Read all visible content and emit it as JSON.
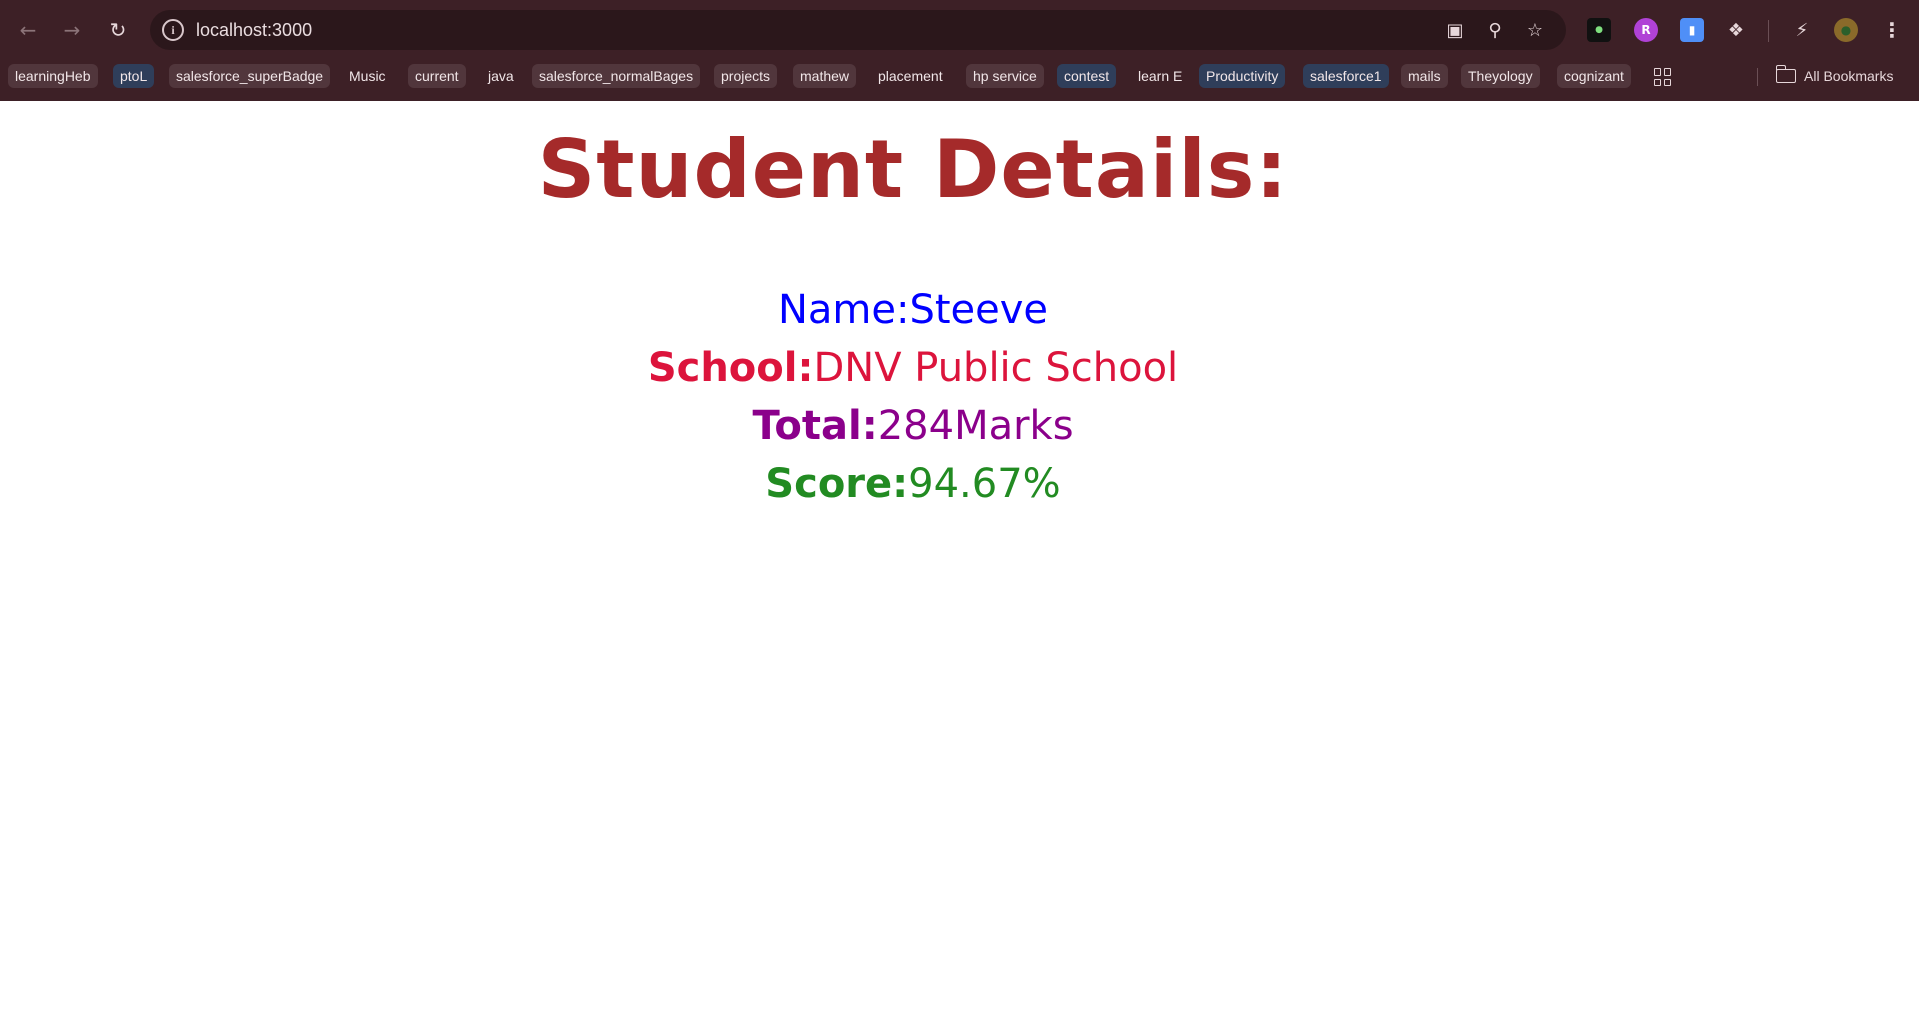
{
  "browser": {
    "url": "localhost:3000",
    "bookmarks": [
      {
        "label": "learningHeb",
        "style": "chip"
      },
      {
        "label": "ptoL",
        "style": "blue"
      },
      {
        "label": "salesforce_superBadge",
        "style": "chip"
      },
      {
        "label": "Music",
        "style": "plain"
      },
      {
        "label": "current",
        "style": "chip"
      },
      {
        "label": "java",
        "style": "plain"
      },
      {
        "label": "salesforce_normalBages",
        "style": "chip"
      },
      {
        "label": "projects",
        "style": "chip"
      },
      {
        "label": "mathew",
        "style": "chip"
      },
      {
        "label": "placement",
        "style": "plain"
      },
      {
        "label": "hp service",
        "style": "chip"
      },
      {
        "label": "contest",
        "style": "blue"
      },
      {
        "label": "learn E",
        "style": "plain"
      },
      {
        "label": "Productivity",
        "style": "blue"
      },
      {
        "label": "salesforce1",
        "style": "blue"
      },
      {
        "label": "mails",
        "style": "chip"
      },
      {
        "label": "Theyology",
        "style": "chip"
      },
      {
        "label": "cognizant",
        "style": "chip"
      }
    ],
    "all_bookmarks_label": "All Bookmarks",
    "icons": {
      "back": "arrow-left-icon",
      "forward": "arrow-right-icon",
      "reload": "reload-icon",
      "site_info": "info-icon",
      "install": "install-app-icon",
      "zoom": "zoom-icon",
      "bookmark": "star-icon",
      "extensions": "puzzle-icon",
      "menu": "kebab-menu-icon"
    }
  },
  "page": {
    "heading": "Student Details:",
    "fields": [
      {
        "label": "Name:",
        "value": "Steeve",
        "color": "#0000ff"
      },
      {
        "label": "School:",
        "value": "DNV Public School",
        "color": "#dc143c"
      },
      {
        "label": "Total:",
        "value": "284Marks",
        "color": "#8b008b"
      },
      {
        "label": "Score:",
        "value": "94.67%",
        "color": "#228b22"
      }
    ],
    "heading_color": "#a52a2a"
  }
}
